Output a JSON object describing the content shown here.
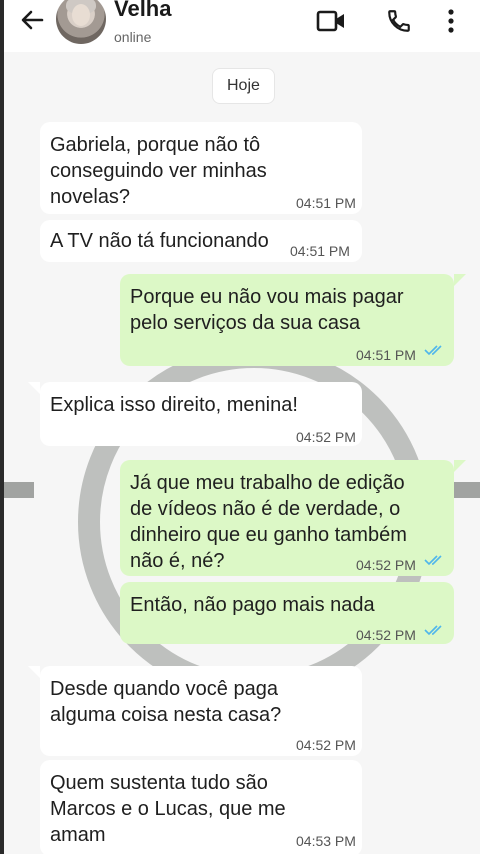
{
  "header": {
    "contact_name": "Velha",
    "status": "online"
  },
  "date_chip": "Hoje",
  "messages": [
    {
      "side": "in",
      "lines": [
        "Gabriela, porque não tô",
        "conseguindo ver minhas",
        "novelas?"
      ],
      "time": "04:51 PM"
    },
    {
      "side": "in",
      "lines": [
        "A TV não tá funcionando"
      ],
      "time": "04:51 PM"
    },
    {
      "side": "out",
      "lines": [
        "Porque eu não vou mais pagar",
        "pelo serviços da sua casa"
      ],
      "time": "04:51 PM",
      "read": true
    },
    {
      "side": "in",
      "lines": [
        "Explica isso direito, menina!"
      ],
      "time": "04:52 PM"
    },
    {
      "side": "out",
      "lines": [
        "Já que meu trabalho de edição",
        "de vídeos não é de verdade, o",
        "dinheiro que eu ganho também",
        "não é, né?"
      ],
      "time": "04:52 PM",
      "read": true
    },
    {
      "side": "out",
      "lines": [
        "Então, não pago mais nada"
      ],
      "time": "04:52 PM",
      "read": true
    },
    {
      "side": "in",
      "lines": [
        "Desde quando você paga",
        "alguma coisa nesta casa?"
      ],
      "time": "04:52 PM"
    },
    {
      "side": "in",
      "lines": [
        "Quem sustenta tudo são",
        "Marcos e o Lucas, que me",
        "amam"
      ],
      "time": "04:53 PM"
    }
  ],
  "icons": {
    "back": "arrow-left-icon",
    "video": "video-camera-icon",
    "call": "phone-icon",
    "more": "more-vertical-icon",
    "read_receipt": "double-check-icon"
  },
  "colors": {
    "outgoing_bubble": "#dcf8c6",
    "incoming_bubble": "#ffffff",
    "chat_background": "#f6f6f6",
    "read_tick": "#4fb6ec"
  }
}
